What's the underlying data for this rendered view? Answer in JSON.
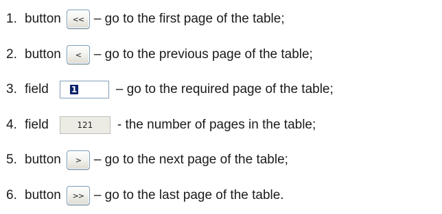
{
  "items": [
    {
      "number": "1.",
      "type_word": "button",
      "control_label": "<<",
      "description": "– go to the first page of the table;"
    },
    {
      "number": "2.",
      "type_word": "button",
      "control_label": "<",
      "description": "– go to the previous page of the table;"
    },
    {
      "number": "3.",
      "type_word": "field",
      "control_value": "1",
      "description": "– go to the required page of the table;"
    },
    {
      "number": "4.",
      "type_word": "field",
      "control_value": "121",
      "description": "- the number of pages in the table;"
    },
    {
      "number": "5.",
      "type_word": "button",
      "control_label": ">",
      "description": "– go to the next page of the table;"
    },
    {
      "number": "6.",
      "type_word": "button",
      "control_label": ">>",
      "description": "– go to the last page of the table."
    }
  ]
}
